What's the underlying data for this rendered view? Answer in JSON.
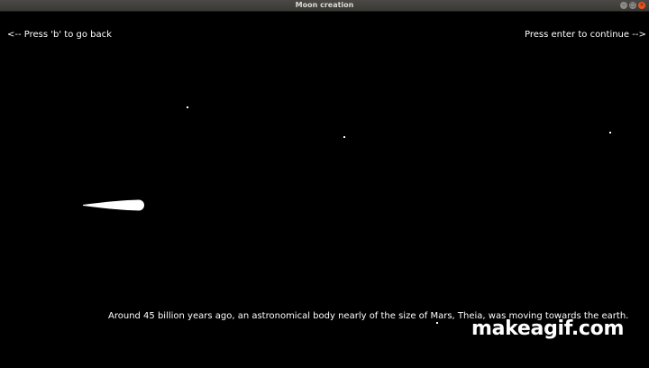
{
  "window": {
    "title": "Moon creation"
  },
  "controls": {
    "close_icon": "close-icon",
    "maximize_icon": "maximize-icon",
    "minimize_icon": "minimize-icon"
  },
  "hints": {
    "back": "<-- Press 'b' to go back",
    "continue": "Press enter to continue -->"
  },
  "scene": {
    "caption": "Around 45 billion years ago, an astronomical body nearly of the size of Mars, Theia, was moving  towards the earth."
  },
  "watermark": {
    "text": "makeagif.com"
  },
  "colors": {
    "background": "#000000",
    "text": "#ffffff",
    "titlebar": "#3a3935",
    "close_button": "#e95420"
  }
}
